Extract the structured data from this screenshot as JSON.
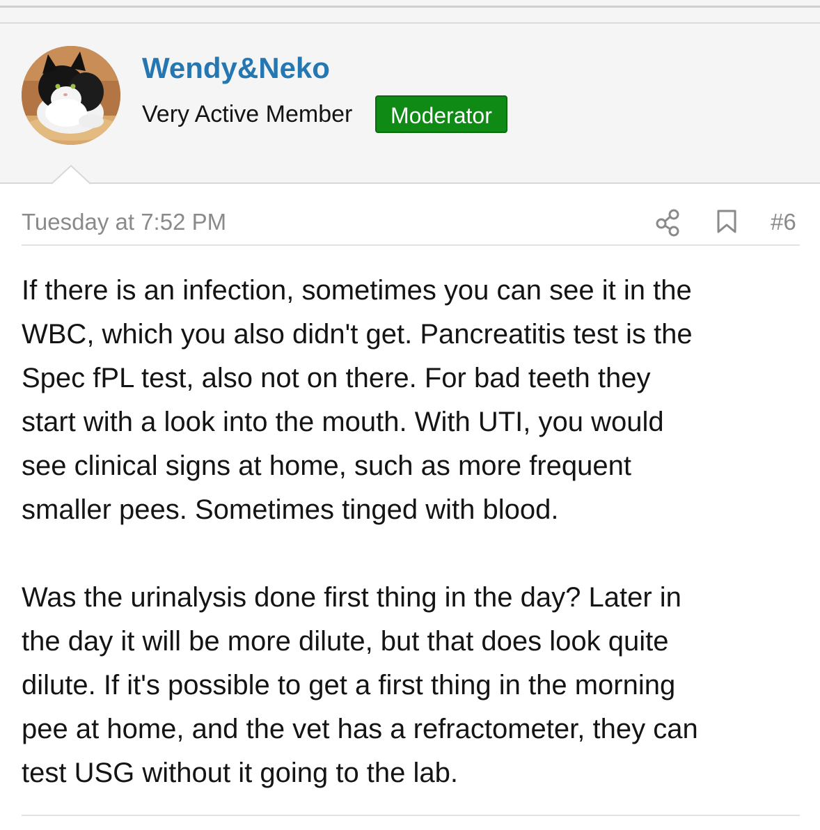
{
  "user": {
    "name": "Wendy&Neko",
    "title": "Very Active Member",
    "badge": "Moderator",
    "avatar_icon": "cat-avatar"
  },
  "post": {
    "timestamp": "Tuesday at 7:52 PM",
    "number": "#6",
    "actions": {
      "share_icon": "share-icon",
      "bookmark_icon": "bookmark-icon"
    },
    "paragraphs": [
      "If there is an infection, sometimes you can see it in the\nWBC, which you also didn't get. Pancreatitis test is the\nSpec fPL test, also not on there. For bad teeth they\nstart with a look into the mouth. With UTI, you would\nsee clinical signs at home, such as more frequent\nsmaller pees. Sometimes tinged with blood.",
      "Was the urinalysis done first thing in the day? Later in\nthe day it will be more dilute, but that does look quite\ndilute. If it's possible to get a first thing in the morning\npee at home, and the vet has a refractometer, they can\ntest USG without it going to the lab."
    ]
  },
  "colors": {
    "username": "#2577b1",
    "badge_background": "#0f8a14",
    "meta_text": "#8a8a8a",
    "header_background": "#f5f5f5"
  }
}
